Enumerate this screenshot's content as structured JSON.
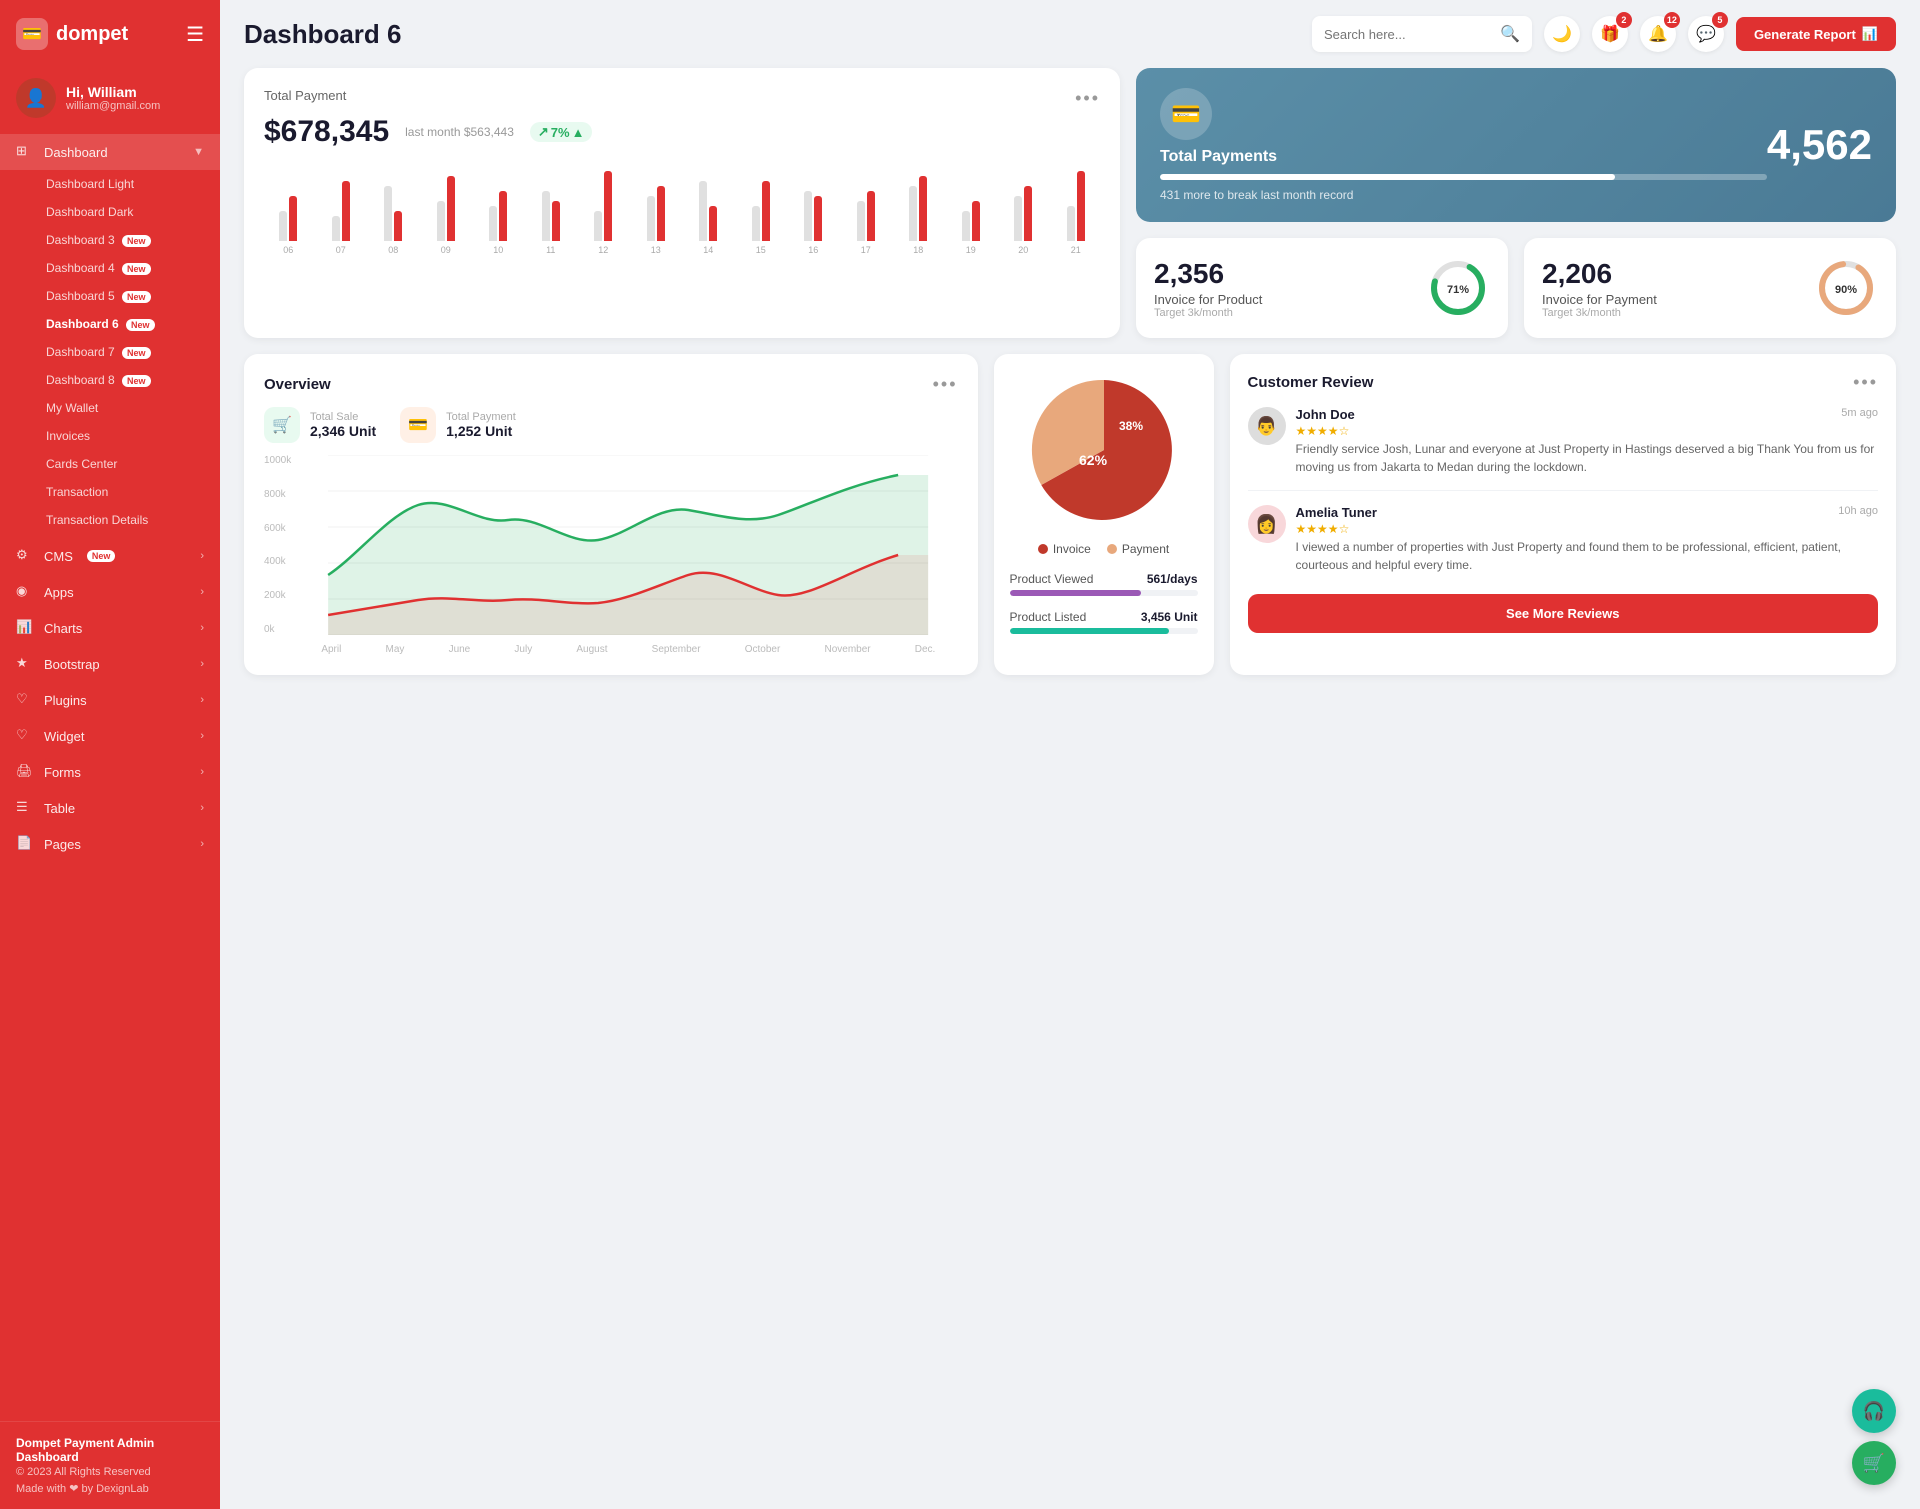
{
  "app": {
    "logo": "💳",
    "name": "dompet",
    "menu_icon": "☰"
  },
  "user": {
    "greeting": "Hi,",
    "name": "William",
    "email": "william@gmail.com",
    "avatar": "👤"
  },
  "sidebar": {
    "dashboard_label": "Dashboard",
    "items": [
      {
        "label": "Dashboard Light",
        "id": "dashboard-light"
      },
      {
        "label": "Dashboard Dark",
        "id": "dashboard-dark"
      },
      {
        "label": "Dashboard 3",
        "id": "dashboard-3",
        "badge": "New"
      },
      {
        "label": "Dashboard 4",
        "id": "dashboard-4",
        "badge": "New"
      },
      {
        "label": "Dashboard 5",
        "id": "dashboard-5",
        "badge": "New"
      },
      {
        "label": "Dashboard 6",
        "id": "dashboard-6",
        "badge": "New",
        "active": true
      },
      {
        "label": "Dashboard 7",
        "id": "dashboard-7",
        "badge": "New"
      },
      {
        "label": "Dashboard 8",
        "id": "dashboard-8",
        "badge": "New"
      },
      {
        "label": "My Wallet",
        "id": "my-wallet"
      },
      {
        "label": "Invoices",
        "id": "invoices"
      },
      {
        "label": "Cards Center",
        "id": "cards-center"
      },
      {
        "label": "Transaction",
        "id": "transaction"
      },
      {
        "label": "Transaction Details",
        "id": "transaction-details"
      }
    ],
    "menu_items": [
      {
        "label": "CMS",
        "badge": "New",
        "has_arrow": true
      },
      {
        "label": "Apps",
        "has_arrow": true
      },
      {
        "label": "Charts",
        "has_arrow": true
      },
      {
        "label": "Bootstrap",
        "has_arrow": true
      },
      {
        "label": "Plugins",
        "has_arrow": true
      },
      {
        "label": "Widget",
        "has_arrow": true
      },
      {
        "label": "Forms",
        "has_arrow": true
      },
      {
        "label": "Table",
        "has_arrow": true
      },
      {
        "label": "Pages",
        "has_arrow": true
      }
    ],
    "footer": {
      "title": "Dompet Payment Admin Dashboard",
      "copyright": "© 2023 All Rights Reserved",
      "made_by": "Made with ❤ by DexignLab"
    }
  },
  "topbar": {
    "title": "Dashboard 6",
    "search_placeholder": "Search here...",
    "icons": {
      "moon": "🌙",
      "gift": "🎁",
      "bell": "🔔",
      "chat": "💬"
    },
    "badges": {
      "gift": "2",
      "bell": "12",
      "chat": "5"
    },
    "generate_btn": "Generate Report"
  },
  "total_payment": {
    "label": "Total Payment",
    "amount": "$678,345",
    "last_month_label": "last month $563,443",
    "trend": "7%",
    "bars": [
      {
        "gray": 30,
        "red": 45
      },
      {
        "gray": 25,
        "red": 60
      },
      {
        "gray": 55,
        "red": 30
      },
      {
        "gray": 40,
        "red": 65
      },
      {
        "gray": 35,
        "red": 50
      },
      {
        "gray": 50,
        "red": 40
      },
      {
        "gray": 30,
        "red": 70
      },
      {
        "gray": 45,
        "red": 55
      },
      {
        "gray": 60,
        "red": 35
      },
      {
        "gray": 35,
        "red": 60
      },
      {
        "gray": 50,
        "red": 45
      },
      {
        "gray": 40,
        "red": 50
      },
      {
        "gray": 55,
        "red": 65
      },
      {
        "gray": 30,
        "red": 40
      },
      {
        "gray": 45,
        "red": 55
      },
      {
        "gray": 35,
        "red": 70
      }
    ],
    "x_labels": [
      "06",
      "07",
      "08",
      "09",
      "10",
      "11",
      "12",
      "13",
      "14",
      "15",
      "16",
      "17",
      "18",
      "19",
      "20",
      "21"
    ]
  },
  "total_payments_widget": {
    "title": "Total Payments",
    "subtitle": "431 more to break last month record",
    "number": "4,562",
    "progress": 75
  },
  "invoice_product": {
    "number": "2,356",
    "label": "Invoice for Product",
    "target": "Target 3k/month",
    "percent": 71,
    "color": "#27ae60"
  },
  "invoice_payment": {
    "number": "2,206",
    "label": "Invoice for Payment",
    "target": "Target 3k/month",
    "percent": 90,
    "color": "#e03131"
  },
  "overview": {
    "title": "Overview",
    "total_sale": {
      "label": "Total Sale",
      "value": "2,346 Unit"
    },
    "total_payment": {
      "label": "Total Payment",
      "value": "1,252 Unit"
    },
    "y_labels": [
      "1000k",
      "800k",
      "600k",
      "400k",
      "200k",
      "0k"
    ],
    "x_labels": [
      "April",
      "May",
      "June",
      "July",
      "August",
      "September",
      "October",
      "November",
      "Dec."
    ]
  },
  "pie_chart": {
    "invoice_pct": 62,
    "payment_pct": 38,
    "invoice_color": "#c0392b",
    "payment_color": "#e8a87c",
    "legend": {
      "invoice": "Invoice",
      "payment": "Payment"
    }
  },
  "product_stats": {
    "viewed": {
      "label": "Product Viewed",
      "value": "561/days",
      "color": "#9b59b6",
      "percent": 70
    },
    "listed": {
      "label": "Product Listed",
      "value": "3,456 Unit",
      "color": "#1abc9c",
      "percent": 85
    }
  },
  "customer_review": {
    "title": "Customer Review",
    "reviews": [
      {
        "name": "John Doe",
        "time": "5m ago",
        "stars": 4,
        "text": "Friendly service Josh, Lunar and everyone at Just Property in Hastings deserved a big Thank You from us for moving us from Jakarta to Medan during the lockdown.",
        "avatar": "👨"
      },
      {
        "name": "Amelia Tuner",
        "time": "10h ago",
        "stars": 4,
        "text": "I viewed a number of properties with Just Property and found them to be professional, efficient, patient, courteous and helpful every time.",
        "avatar": "👩"
      }
    ],
    "see_more_btn": "See More Reviews"
  },
  "fab": {
    "support": "🎧",
    "cart": "🛒"
  }
}
